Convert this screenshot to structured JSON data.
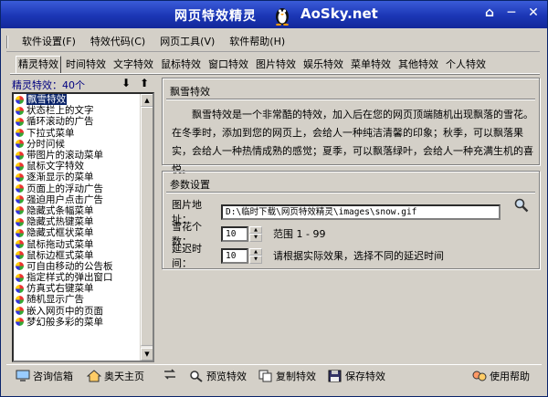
{
  "titlebar": {
    "title": "网页特效精灵",
    "brand": "AoSky.net",
    "icons": [
      "home-icon",
      "minimize-icon",
      "close-icon"
    ]
  },
  "menu": [
    "软件设置(F)",
    "特效代码(C)",
    "网页工具(V)",
    "软件帮助(H)"
  ],
  "tabs": [
    "精灵特效",
    "时间特效",
    "文字特效",
    "鼠标特效",
    "窗口特效",
    "图片特效",
    "娱乐特效",
    "菜单特效",
    "其他特效",
    "个人特效"
  ],
  "left": {
    "count_label": "精灵特效：40个",
    "items": [
      "飘雪特效",
      "状态栏上的文字",
      "循环滚动的广告",
      "下拉式菜单",
      "分时问候",
      "带图片的滚动菜单",
      "鼠标文字特效",
      "逐渐显示的菜单",
      "页面上的浮动广告",
      "强迫用户点击广告",
      "隐藏式条幅菜单",
      "隐藏式热键菜单",
      "隐藏式框状菜单",
      "鼠标拖动式菜单",
      "鼠标边框式菜单",
      "可自由移动的公告板",
      "指定样式的弹出窗口",
      "仿真式右键菜单",
      "随机显示广告",
      "嵌入网页中的页面",
      "梦幻般多彩的菜单"
    ],
    "selected_index": 0
  },
  "effect": {
    "title": "飘雪特效",
    "description": "飘雪特效是一个非常酷的特效，加入后在您的网页顶端随机出现飘落的雪花。在冬季时，添加到您的网页上，会给人一种纯洁清馨的印象；秋季，可以飘落果实，会给人一种热情成熟的感觉；夏季，可以飘落绿叶，会给人一种充满生机的喜悦。"
  },
  "params": {
    "title": "参数设置",
    "image_label": "图片地址：",
    "image_value": "D:\\临时下载\\网页特效精灵\\images\\snow.gif",
    "count_label": "雪花个数：",
    "count_value": "10",
    "range_text": "范围 1 - 99",
    "delay_label": "延迟时间：",
    "delay_value": "10",
    "delay_hint": "请根据实际效果，选择不同的延迟时间"
  },
  "bottom": {
    "mail": "咨询信箱",
    "home": "奥天主页",
    "preview": "预览特效",
    "copy": "复制特效",
    "save": "保存特效",
    "help": "使用帮助"
  }
}
